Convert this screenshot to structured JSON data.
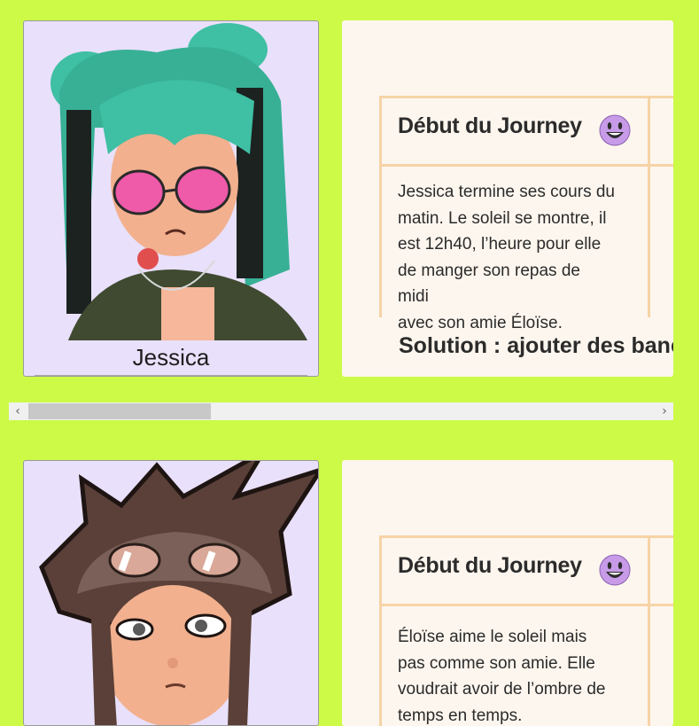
{
  "cards": [
    {
      "name": "Jessica",
      "journey_title": "Début du Journey",
      "emoji": "smiley",
      "text_lines": [
        "Jessica termine ses cours du",
        "matin.  Le soleil se montre, il",
        "est 12h40, l’heure pour elle",
        "de manger son repas de midi",
        "avec son amie Éloïse."
      ],
      "solution": "Solution : ajouter des banc"
    },
    {
      "journey_title": "Début du Journey",
      "emoji": "smiley",
      "text_lines": [
        "Éloïse aime le soleil mais",
        "pas comme son amie. Elle",
        "voudrait avoir de l’ombre de",
        "temps en temps."
      ]
    }
  ],
  "scrollbar": {
    "left_arrow": "‹",
    "right_arrow": "›",
    "thumb_fraction": 0.27
  },
  "colors": {
    "background": "#ccfa47",
    "card_bg": "#e9e0fb",
    "panel_bg": "#fdf6ee",
    "table_border": "#f6d3a6",
    "emoji": "#c79be8"
  }
}
